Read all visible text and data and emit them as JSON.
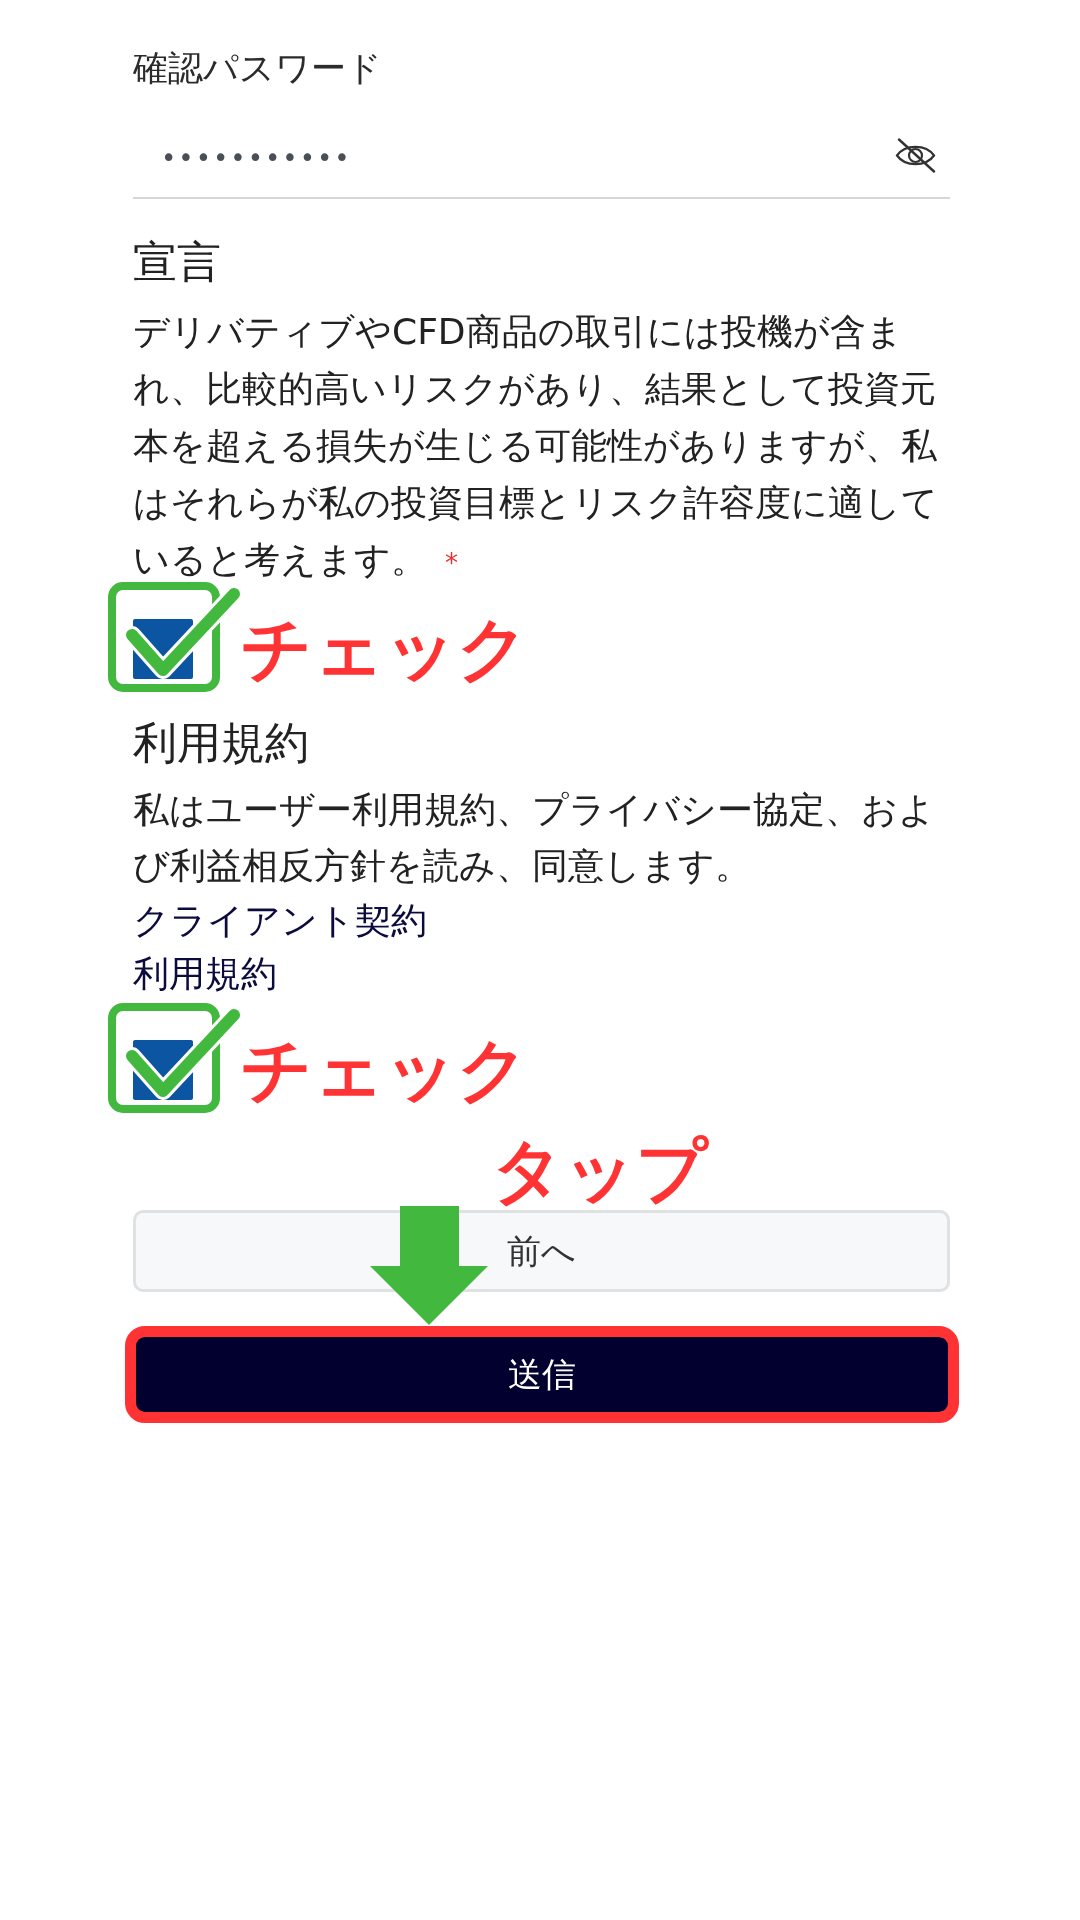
{
  "password_field": {
    "label": "確認パスワード",
    "value": "•••••••••••",
    "revealed": false
  },
  "declaration": {
    "title": "宣言",
    "text": "デリバティブやCFD商品の取引には投機が含まれ、比較的高いリスクがあり、結果として投資元本を超える損失が生じる可能性がありますが、私はそれらが私の投資目標とリスク許容度に適していると考えます。",
    "required_mark": "*",
    "checked": true,
    "callout": "チェック"
  },
  "terms": {
    "title": "利用規約",
    "text": "私はユーザー利用規約、プライバシー協定、および利益相反方針を読み、同意します。",
    "links": [
      "クライアント契約",
      "利用規約"
    ],
    "checked": true,
    "callout": "チェック"
  },
  "buttons": [
    {
      "label": "前へ",
      "kind": "secondary",
      "highlighted": false
    },
    {
      "label": "送信",
      "kind": "primary",
      "highlighted": true,
      "callout": "タップ"
    }
  ]
}
